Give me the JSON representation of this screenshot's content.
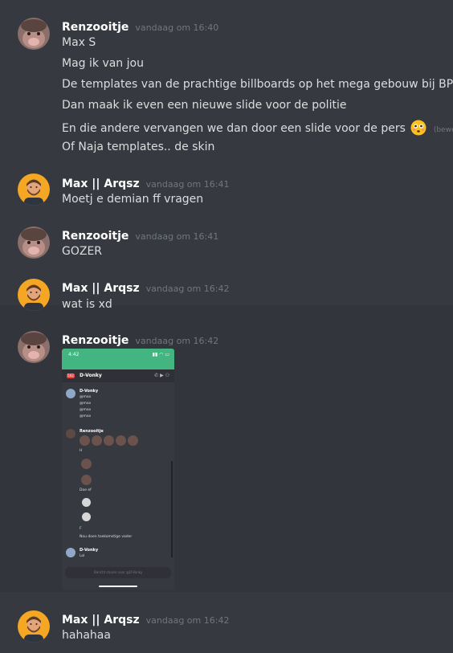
{
  "messages": [
    {
      "author": "Renzooitje",
      "timestamp": "vandaag om 16:40",
      "avatar": "mole-avatar",
      "lines": [
        "Max S",
        "Mag ik van jou",
        "De templates van de prachtige billboards op het mega gebouw bij BP",
        "Dan maak ik even een nieuwe slide voor de politie",
        "En die andere vervangen we dan door een slide voor de pers",
        "Of Naja templates.. de skin"
      ],
      "edited_label": "(bewerkt)",
      "emoji": "flushed-face-emoji"
    },
    {
      "author": "Max || Arqsz",
      "timestamp": "vandaag om 16:41",
      "avatar": "bearded-man-avatar",
      "lines": [
        "Moetj e demian ff vragen"
      ]
    },
    {
      "author": "Renzooitje",
      "timestamp": "vandaag om 16:41",
      "avatar": "mole-avatar",
      "lines": [
        "GOZER"
      ]
    },
    {
      "author": "Max || Arqsz",
      "timestamp": "vandaag om 16:42",
      "avatar": "bearded-man-avatar",
      "lines": [
        "wat is xd"
      ]
    },
    {
      "author": "Renzooitje",
      "timestamp": "vandaag om 16:42",
      "avatar": "mole-avatar",
      "attachment": {
        "status_time": "4:42",
        "channel": "D-Vonky",
        "badge": "562",
        "entries": [
          {
            "author": "D-Vonky",
            "time": "vandaag om 16:39",
            "lines": [
              "@max",
              "@max",
              "@max",
              "@max"
            ]
          },
          {
            "author": "Renzooitje",
            "time": "vandaag om 16:39",
            "lines": [
              "H",
              "Doe ef",
              "F",
              "Nou doen toekomstige vader"
            ]
          },
          {
            "author": "D-Vonky",
            "time": "vandaag om 16:40",
            "lines": [
              "Lol"
            ]
          }
        ],
        "input_placeholder": "Bericht sturen naar @D-Vonky"
      }
    },
    {
      "author": "Max || Arqsz",
      "timestamp": "vandaag om 16:42",
      "avatar": "bearded-man-avatar",
      "lines": [
        "hahahaa"
      ]
    }
  ],
  "colors": {
    "background": "#36393f",
    "hover": "#32353b",
    "username": "#ffffff",
    "timestamp": "#72767d",
    "text": "#dcddde",
    "phone_status_green": "#43b581"
  }
}
